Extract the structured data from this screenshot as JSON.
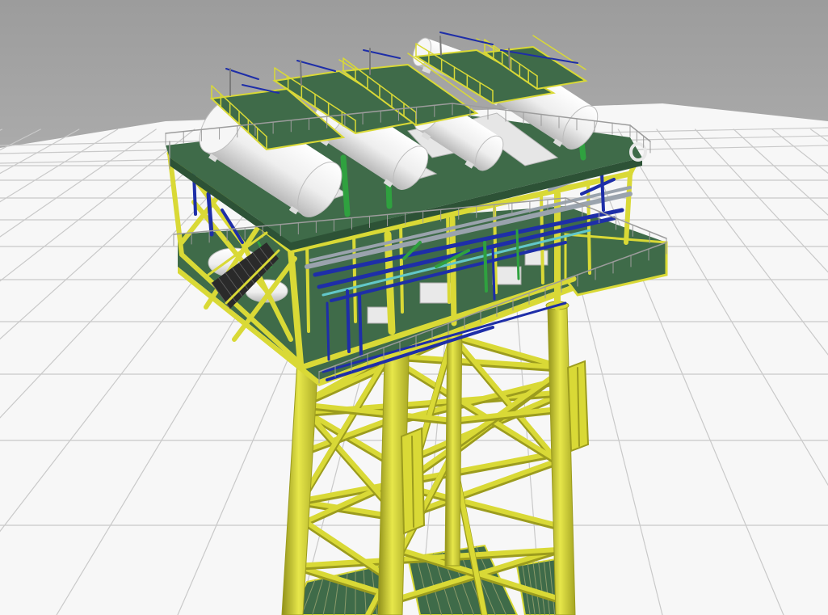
{
  "viewport": {
    "kind": "3d-model-viewport",
    "model": "offshore-platform",
    "colors": {
      "sky_top": "#9c9c9c",
      "sky_horizon": "#d8d8d8",
      "floor": "#f7f7f7",
      "grid_line": "#c9c9c9",
      "jacket_yellow": "#d9d936",
      "jacket_shade": "#9c9c1e",
      "deck_green": "#3f6b49",
      "deck_green_dark": "#2d5236",
      "vessel_white": "#f1f1f1",
      "vessel_shade": "#bdbdbd",
      "pipe_blue": "#1e2ea8",
      "pipe_green": "#2fa13f",
      "pipe_grey": "#9aa3ad",
      "pipe_cyan": "#62c7c9",
      "handrail_grey": "#9c9c9c",
      "stair_dark": "#2a2a2a"
    },
    "layers": [
      "floor-grid",
      "jacket-legs",
      "jacket-bracing",
      "grating-panels",
      "cellar-deck",
      "piping",
      "main-deck",
      "pressure-vessels",
      "top-walkways",
      "handrails",
      "stairway"
    ]
  }
}
